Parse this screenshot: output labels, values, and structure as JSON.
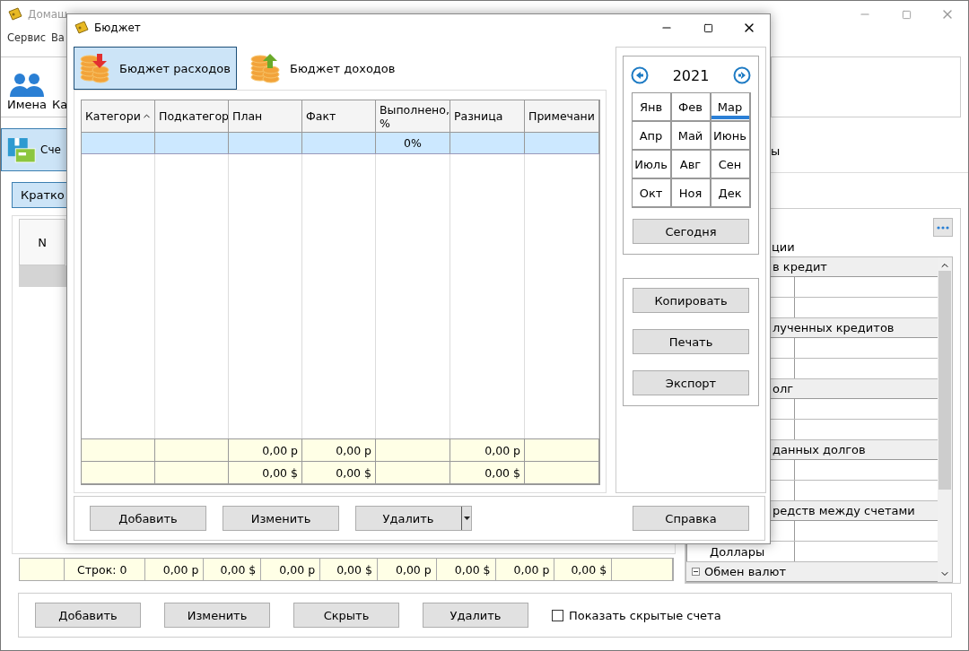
{
  "main_window": {
    "title": "Домаш",
    "menu": [
      "Сервис",
      "Ва"
    ],
    "toolbar": [
      {
        "label": "Имена",
        "kind": "people"
      },
      {
        "label": "Ка",
        "kind": "plain"
      }
    ],
    "accounts_tab": {
      "label": "Сче",
      "selected": true
    },
    "view_tab": {
      "label": "Кратко",
      "selected": true
    },
    "table": {
      "columns": [
        "N"
      ]
    },
    "footer_row": [
      "Строк: 0",
      "0,00 р",
      "0,00 $",
      "0,00 р",
      "0,00 $",
      "0,00 р",
      "0,00 $",
      "0,00 р",
      "0,00 $"
    ],
    "side_fragment": "ы",
    "operations_label": "ции",
    "tree": {
      "rows": [
        {
          "kind": "group",
          "label": "в кредит"
        },
        {
          "kind": "item"
        },
        {
          "kind": "item"
        },
        {
          "kind": "group",
          "label": "лученных кредитов"
        },
        {
          "kind": "item"
        },
        {
          "kind": "item"
        },
        {
          "kind": "group",
          "label": "олг"
        },
        {
          "kind": "item"
        },
        {
          "kind": "item"
        },
        {
          "kind": "group",
          "label": "данных долгов"
        },
        {
          "kind": "item"
        },
        {
          "kind": "item"
        },
        {
          "kind": "group",
          "label": "редств между счетами"
        },
        {
          "kind": "item"
        },
        {
          "kind": "item",
          "label": "Доллары"
        },
        {
          "kind": "group",
          "label": "Обмен валют",
          "expanded": true
        }
      ]
    },
    "buttons": [
      "Добавить",
      "Изменить",
      "Скрыть",
      "Удалить"
    ],
    "show_hidden": {
      "label": "Показать скрытые счета",
      "checked": false
    }
  },
  "dialog": {
    "title": "Бюджет",
    "tabs": [
      {
        "label": "Бюджет расходов",
        "kind": "expense",
        "selected": true
      },
      {
        "label": "Бюджет доходов",
        "kind": "income",
        "selected": false
      }
    ],
    "table": {
      "columns": [
        {
          "label": "Категори",
          "sorted": true
        },
        {
          "label": "Подкатегор",
          "sorted": false
        },
        {
          "label": "План",
          "sorted": false
        },
        {
          "label": "Факт",
          "sorted": false
        },
        {
          "label": "Выполнено, %",
          "sorted": false
        },
        {
          "label": "Разница",
          "sorted": false
        },
        {
          "label": "Примечани",
          "sorted": false
        }
      ],
      "rows": [
        {
          "selected": true,
          "percent": "0%"
        }
      ],
      "totals": [
        {
          "plan": "0,00 р",
          "fact": "0,00 р",
          "diff": "0,00 р"
        },
        {
          "plan": "0,00 $",
          "fact": "0,00 $",
          "diff": "0,00 $"
        }
      ]
    },
    "calendar": {
      "year": "2021",
      "months": [
        {
          "label": "Янв",
          "selected": false
        },
        {
          "label": "Фев",
          "selected": false
        },
        {
          "label": "Мар",
          "selected": true
        },
        {
          "label": "Апр",
          "selected": false
        },
        {
          "label": "Май",
          "selected": false
        },
        {
          "label": "Июнь",
          "selected": false
        },
        {
          "label": "Июль",
          "selected": false
        },
        {
          "label": "Авг",
          "selected": false
        },
        {
          "label": "Сен",
          "selected": false
        },
        {
          "label": "Окт",
          "selected": false
        },
        {
          "label": "Ноя",
          "selected": false
        },
        {
          "label": "Дек",
          "selected": false
        }
      ],
      "today_button": "Сегодня"
    },
    "actions": [
      "Копировать",
      "Печать",
      "Экспорт"
    ],
    "bottom_buttons": [
      {
        "label": "Добавить",
        "kind": "plain"
      },
      {
        "label": "Изменить",
        "kind": "plain"
      },
      {
        "label": "Удалить",
        "kind": "split"
      }
    ],
    "help_button": "Справка"
  }
}
